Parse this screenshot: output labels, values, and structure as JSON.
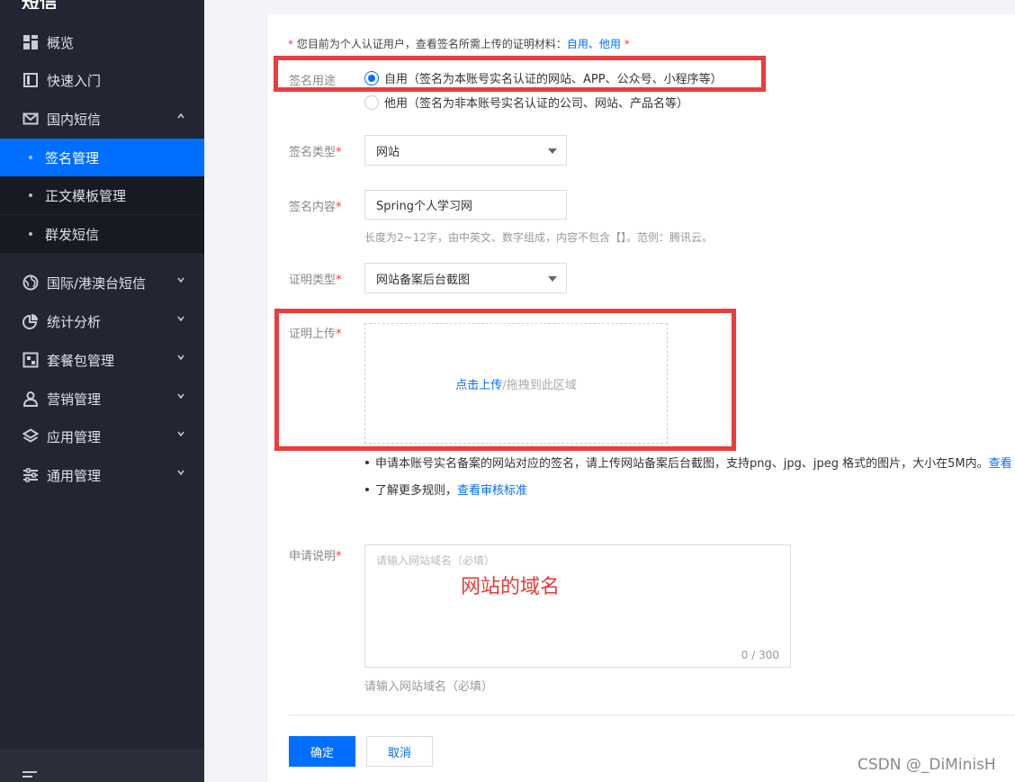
{
  "sidebar": {
    "brand": "短信",
    "items": [
      {
        "label": "概览",
        "icon": "grid-icon"
      },
      {
        "label": "快速入门",
        "icon": "book-icon"
      },
      {
        "label": "国内短信",
        "icon": "mail-icon",
        "expanded": true
      },
      {
        "label": "国际/港澳台短信",
        "icon": "globe-icon"
      },
      {
        "label": "统计分析",
        "icon": "pie-chart-icon"
      },
      {
        "label": "套餐包管理",
        "icon": "package-icon"
      },
      {
        "label": "营销管理",
        "icon": "user-icon"
      },
      {
        "label": "应用管理",
        "icon": "layers-icon"
      },
      {
        "label": "通用管理",
        "icon": "sliders-icon"
      }
    ],
    "subitems": [
      {
        "label": "签名管理",
        "active": true
      },
      {
        "label": "正文模板管理"
      },
      {
        "label": "群发短信"
      }
    ]
  },
  "form": {
    "notice": {
      "star": "*",
      "text": " 您目前为个人认证用户，查看签名所需上传的证明材料：",
      "link1": "自用",
      "sep": "、",
      "link2": "他用",
      "tail": " *"
    },
    "usage": {
      "label": "签名用途",
      "option1": "自用（签名为本账号实名认证的网站、APP、公众号、小程序等）",
      "option2": "他用（签名为非本账号实名认证的公司、网站、产品名等）",
      "selected": "自用"
    },
    "type": {
      "label": "签名类型",
      "star": "*",
      "value": "网站"
    },
    "content": {
      "label": "签名内容",
      "star": "*",
      "value": "Spring个人学习网",
      "hint": "长度为2~12字，由中英文、数字组成，内容不包含【】。范例：腾讯云。"
    },
    "proof_type": {
      "label": "证明类型",
      "star": "*",
      "value": "网站备案后台截图"
    },
    "proof_upload": {
      "label": "证明上传",
      "star": "*",
      "link": "点击上传",
      "rest": "/拖拽到此区域",
      "bullet1": "申请本账号实名备案的网站对应的签名，请上传网站备案后台截图，支持png、jpg、jpeg 格式的图片，大小在5M内。",
      "bullet1_link": "查看",
      "bullet2": "了解更多规则，",
      "bullet2_link": "查看审核标准"
    },
    "description": {
      "label": "申请说明",
      "star": "*",
      "placeholder": "请输入网站域名（必填）",
      "count": "0 / 300",
      "hint": "请输入网站域名（必填）",
      "annotation": "网站的域名"
    },
    "buttons": {
      "confirm": "确定",
      "cancel": "取消"
    }
  },
  "watermark": "CSDN @_DiMinisH",
  "colors": {
    "accent": "#006eff",
    "sidebar_bg": "#232632",
    "highlight_box": "#ee3b3b",
    "required": "#e54545"
  }
}
